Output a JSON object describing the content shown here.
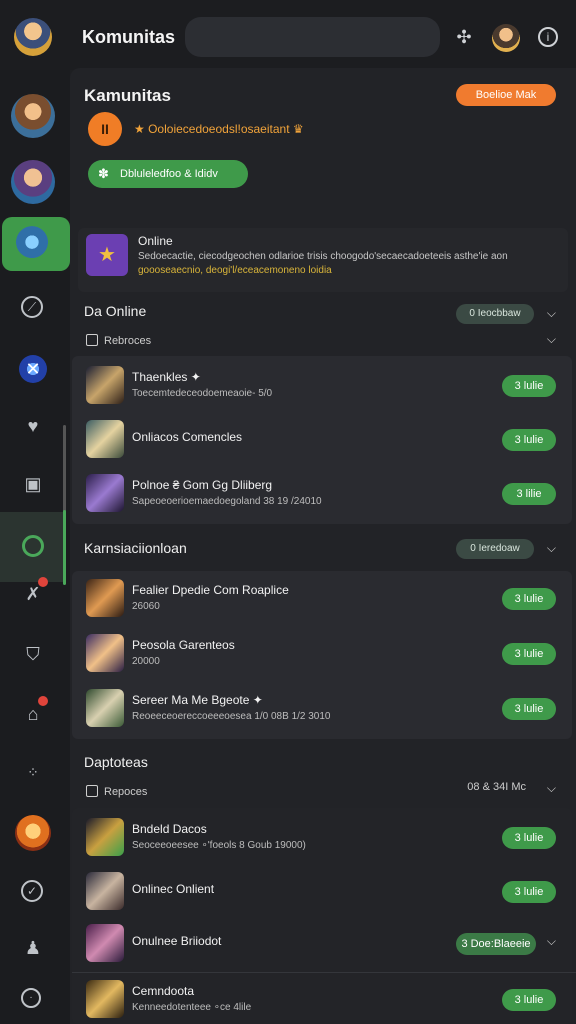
{
  "topbar": {
    "title": "Komunitas",
    "search_placeholder": "",
    "icons": [
      "share-icon",
      "avatar",
      "info-icon"
    ]
  },
  "sidebar": {
    "items": [
      {
        "name": "profile-avatar"
      },
      {
        "name": "guild-avatar"
      },
      {
        "name": "active-server"
      },
      {
        "name": "clock-icon"
      },
      {
        "name": "blue-emblem"
      },
      {
        "name": "heart-icon"
      },
      {
        "name": "ticket-icon"
      },
      {
        "name": "online-icon"
      },
      {
        "name": "map-icon"
      },
      {
        "name": "shield-icon"
      },
      {
        "name": "home-icon"
      },
      {
        "name": "dots-icon"
      },
      {
        "name": "fire-avatar"
      },
      {
        "name": "check-icon"
      },
      {
        "name": "person-icon"
      },
      {
        "name": "power-icon"
      }
    ],
    "badge_color": "#e0443b",
    "active_color": "#3f9a4a"
  },
  "main": {
    "title": "Kamunitas",
    "orange_button": "Boelioe Mak",
    "orange_circle": "II",
    "orange_text": "★ Ooloiecedoeodsl!osaeitant ♛",
    "green_pill": "Dbluleledfoo & Ididv",
    "info": {
      "title": "Online",
      "description": "Sedoecactie, ciecodgeochen odlarioe trisis choogodo'secaecadoeteeis asthe'ie aon",
      "link": "goooseaecnio, deogi'l/eceacemoneno loidia"
    },
    "section1": {
      "title": "Da Online",
      "pill": "0 Ieocbbaw",
      "sub_label": "Rebroces"
    },
    "list1": [
      {
        "name": "Thaenkles ✦",
        "sub": "Toecemtedeceodoemeaoie- 5/0",
        "badge": "3 lulie"
      },
      {
        "name": "Onliacos Comencles",
        "sub": "",
        "badge": "3 lulie"
      },
      {
        "name": "Polnoe ₴ Gom Gg Dliiberg",
        "sub": "Sapeoeoerioemaedoegoland 38 19 /24010",
        "badge": "3 lilie"
      }
    ],
    "section2": {
      "title": "Karnsiaciionloan",
      "pill": "0 Ieredoaw"
    },
    "list2": [
      {
        "name": "Fealier Dpedie Com Roaplice",
        "sub": "26060",
        "badge": "3 lulie"
      },
      {
        "name": "Peosola Garenteos",
        "sub": "20000",
        "badge": "3 lulie"
      },
      {
        "name": "Sereer Ma Me Bgeote ✦",
        "sub": "Reoeeceoereccoeeeoesea 1/0 08B 1/2 3010",
        "badge": "3 lulie"
      }
    ],
    "section3": {
      "title": "Daptoteas",
      "sub_label": "Repoces",
      "meta": "08 & 34I Mc"
    },
    "list3": [
      {
        "name": "Bndeld Dacos",
        "sub": "Seoceeoeesee ∘'foeols 8 Goub 19000)",
        "badge": "3 lulie"
      },
      {
        "name": "Onlinec Onlient",
        "sub": "",
        "badge": "3 lulie"
      },
      {
        "name": "Onulnee Briiodot",
        "sub": "",
        "badge": "3 Doe:Blaeeie"
      },
      {
        "name": "Cemndoota",
        "sub": "Kenneedotenteee ∘ce 4lile",
        "badge": "3 lulie"
      }
    ]
  }
}
